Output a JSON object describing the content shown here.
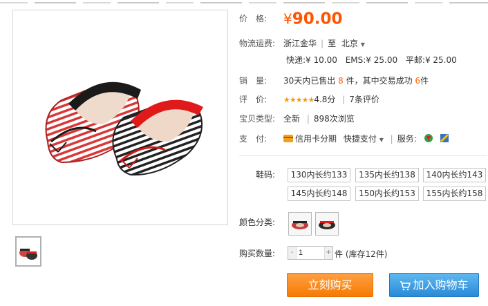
{
  "price": {
    "label": "价　格:",
    "currency": "¥",
    "value": "90.00"
  },
  "shipping": {
    "label": "物流运费:",
    "origin": "浙江金华",
    "to_word": "至",
    "destination": "北京",
    "express": "快递:¥ 10.00",
    "ems": "EMS:¥ 25.00",
    "surface": "平邮:¥ 25.00"
  },
  "sales": {
    "label": "销　量:",
    "prefix": "30天内已售出",
    "sold": "8",
    "middle": "件，其中交易成功",
    "success": "6",
    "suffix": "件"
  },
  "rating": {
    "label": "评　价:",
    "stars": "★★★★★",
    "score": "4.8分",
    "reviews": "7条评价"
  },
  "item_type": {
    "label": "宝贝类型:",
    "condition": "全新",
    "views": "898次浏览"
  },
  "payment": {
    "label": "支　付:",
    "installment": "信用卡分期",
    "quick_pay": "快捷支付",
    "service_label": "服务:"
  },
  "size": {
    "label": "鞋码:",
    "options": [
      "130内长约133",
      "135内长约138",
      "140内长约143",
      "145内长约148",
      "150内长约153",
      "155内长约158"
    ]
  },
  "color": {
    "label": "颜色分类:"
  },
  "quantity": {
    "label": "购买数量:",
    "value": "1",
    "minus": "-",
    "plus": "+",
    "stock": "件 (库存12件)"
  },
  "actions": {
    "buy_now": "立刻购买",
    "add_to_cart": "加入购物车"
  },
  "colors": {
    "price_orange": "#ff5500",
    "buy_orange": "#f57a04",
    "cart_blue": "#2a8ad8"
  }
}
